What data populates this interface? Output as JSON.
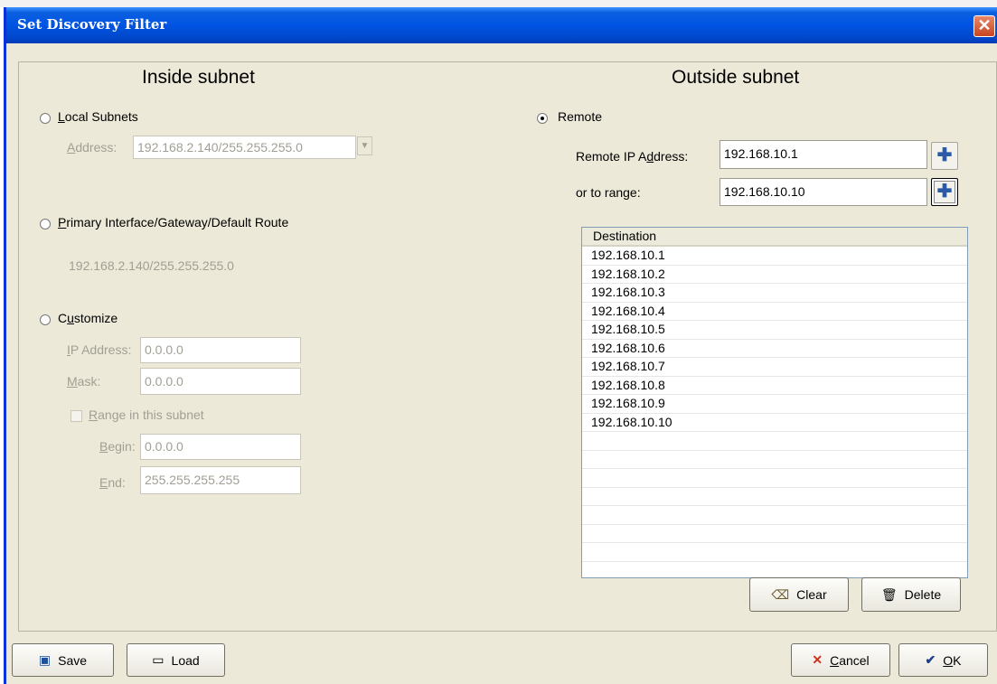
{
  "window": {
    "title": "Set Discovery Filter",
    "close_icon": "close-icon"
  },
  "inside": {
    "heading": "Inside subnet",
    "local": {
      "label_prefix": "",
      "label_u": "L",
      "label_rest": "ocal Subnets",
      "address_label_u": "A",
      "address_label_rest": "ddress:",
      "address_value": "192.168.2.140/255.255.255.0",
      "selected": false
    },
    "primary": {
      "label_u": "P",
      "label_rest": "rimary Interface/Gateway/Default Route",
      "info": "192.168.2.140/255.255.255.0",
      "selected": false
    },
    "custom": {
      "label_prefix": "C",
      "label_u": "u",
      "label_rest": "stomize",
      "selected": false,
      "ip_label_u": "I",
      "ip_label_rest": "P Address:",
      "ip_value": "0.0.0.0",
      "mask_label_u": "M",
      "mask_label_rest": "ask:",
      "mask_value": "0.0.0.0",
      "range_label_u": "R",
      "range_label_rest": "ange in this subnet",
      "range_checked": false,
      "begin_label_u": "B",
      "begin_label_rest": "egin:",
      "begin_value": "0.0.0.0",
      "end_label_u": "E",
      "end_label_rest": "nd:",
      "end_value": "255.255.255.255"
    }
  },
  "outside": {
    "heading": "Outside subnet",
    "remote_label": "Remote",
    "remote_selected": true,
    "ip_label_prefix": "Remote IP A",
    "ip_label_u": "d",
    "ip_label_rest": "dress:",
    "ip_value": "192.168.10.1",
    "range_label": "or to range:",
    "range_value": "192.168.10.10",
    "list_header": "Destination",
    "destinations": [
      "192.168.10.1",
      "192.168.10.2",
      "192.168.10.3",
      "192.168.10.4",
      "192.168.10.5",
      "192.168.10.6",
      "192.168.10.7",
      "192.168.10.8",
      "192.168.10.9",
      "192.168.10.10",
      "",
      "",
      "",
      "",
      "",
      "",
      "",
      ""
    ],
    "clear_label": "Clear",
    "delete_label": "Delete"
  },
  "footer": {
    "save_label": "Save",
    "load_label": "Load",
    "cancel_u": "C",
    "cancel_rest": "ancel",
    "ok_u": "O",
    "ok_rest": "K"
  },
  "colors": {
    "titlebar": "#0054e3",
    "dialog_bg": "#ece9d8",
    "disabled_text": "#a19f94"
  }
}
